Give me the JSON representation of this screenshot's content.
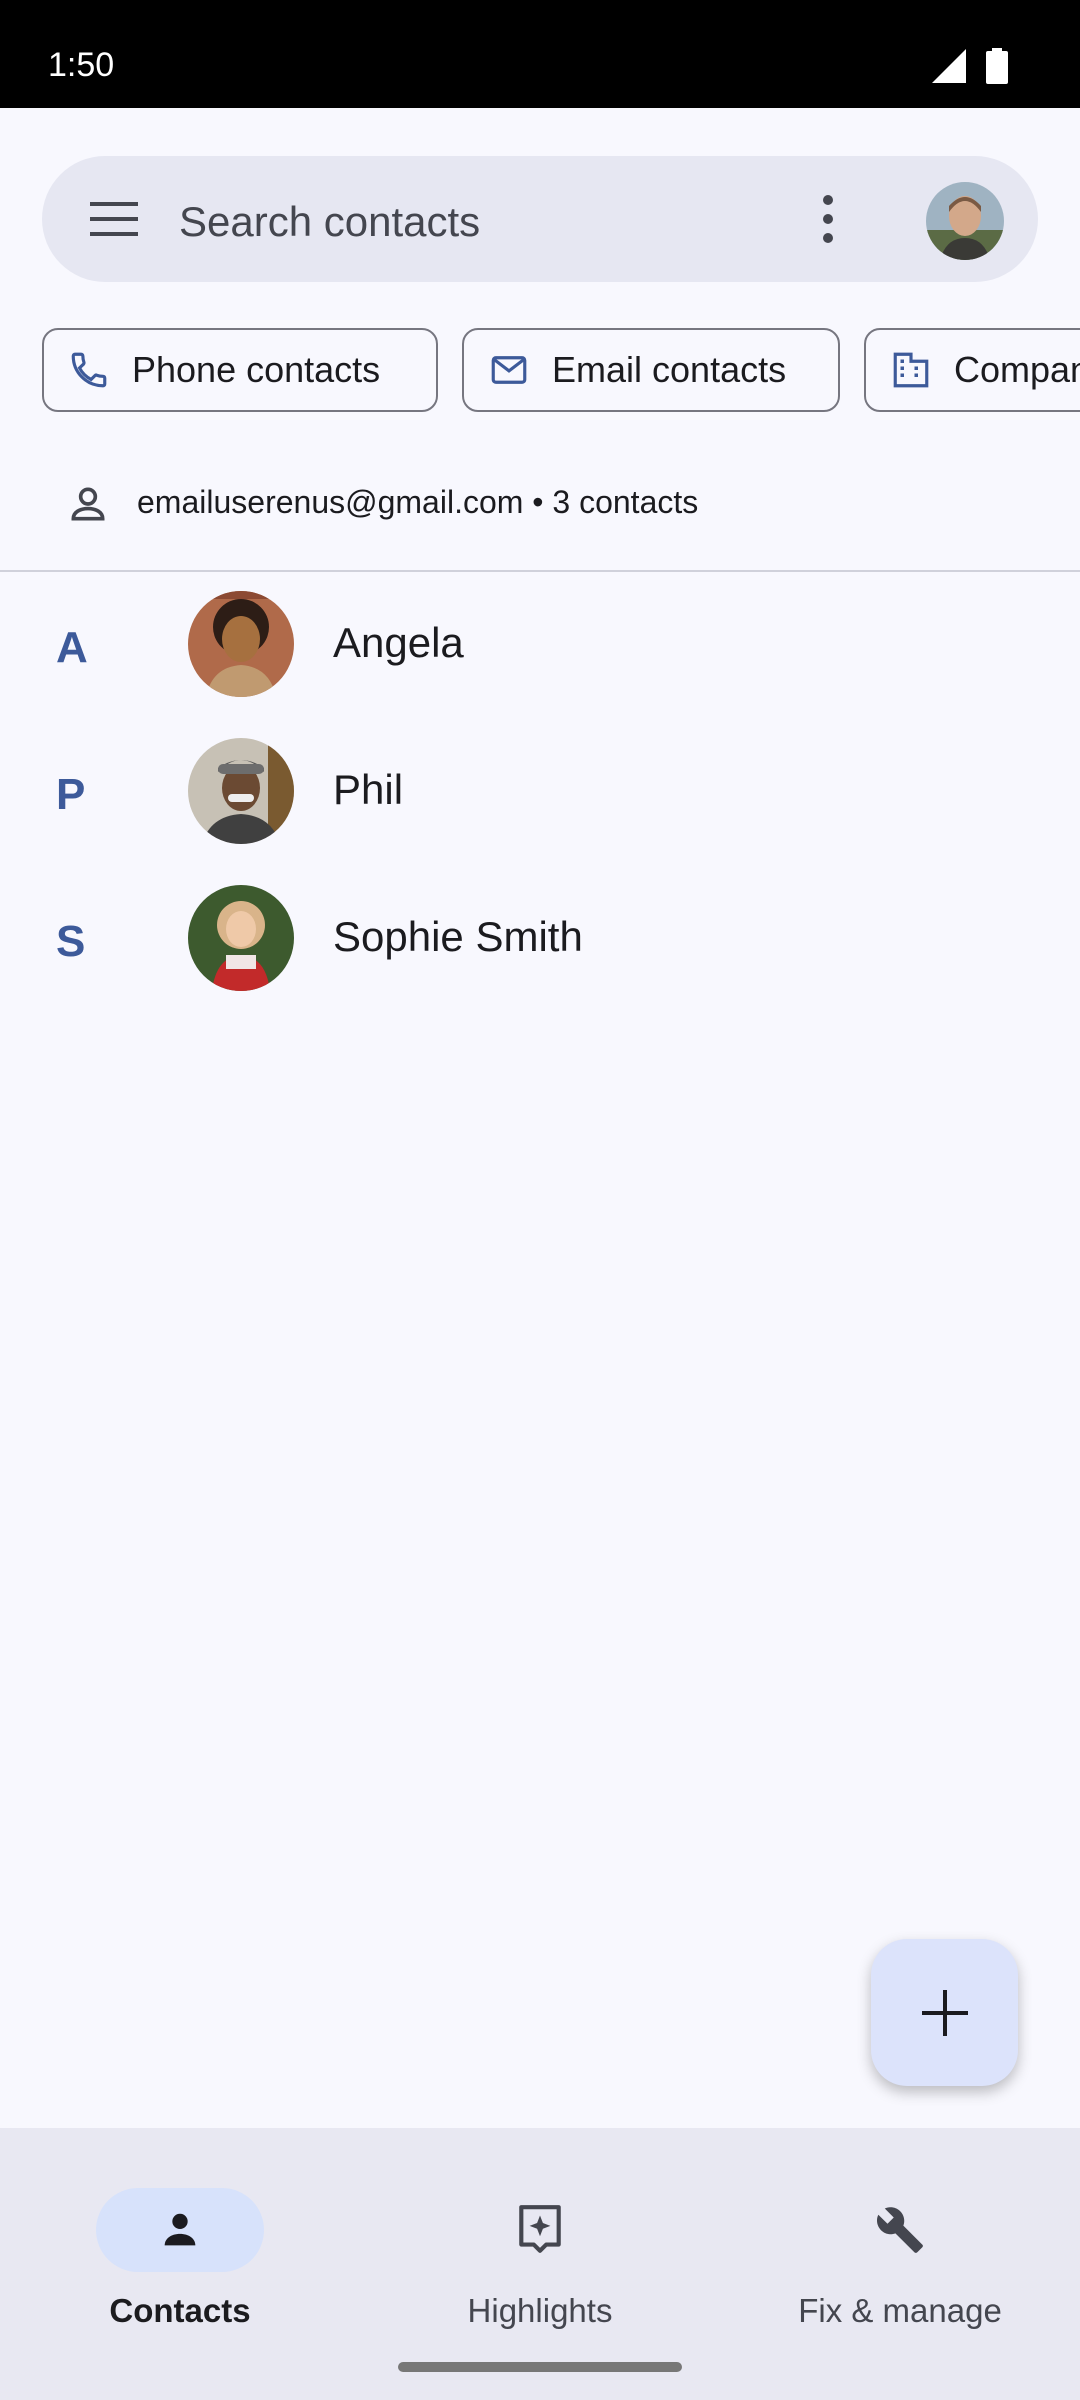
{
  "status_bar": {
    "time": "1:50"
  },
  "search": {
    "placeholder": "Search contacts"
  },
  "chips": [
    {
      "label": "Phone contacts",
      "icon": "phone-icon"
    },
    {
      "label": "Email contacts",
      "icon": "mail-icon"
    },
    {
      "label": "Company",
      "icon": "building-icon"
    }
  ],
  "account": {
    "text": "emailuserenus@gmail.com • 3 contacts"
  },
  "contacts": [
    {
      "letter": "A",
      "name": "Angela"
    },
    {
      "letter": "P",
      "name": "Phil"
    },
    {
      "letter": "S",
      "name": "Sophie Smith"
    }
  ],
  "fab": {
    "icon": "add-icon"
  },
  "nav": [
    {
      "label": "Contacts",
      "icon": "person-icon",
      "active": true
    },
    {
      "label": "Highlights",
      "icon": "highlights-icon",
      "active": false
    },
    {
      "label": "Fix & manage",
      "icon": "wrench-icon",
      "active": false
    }
  ],
  "colors": {
    "accent": "#3d5a9a",
    "fab_bg": "#dce3fb",
    "nav_active": "#d7e2fb"
  }
}
